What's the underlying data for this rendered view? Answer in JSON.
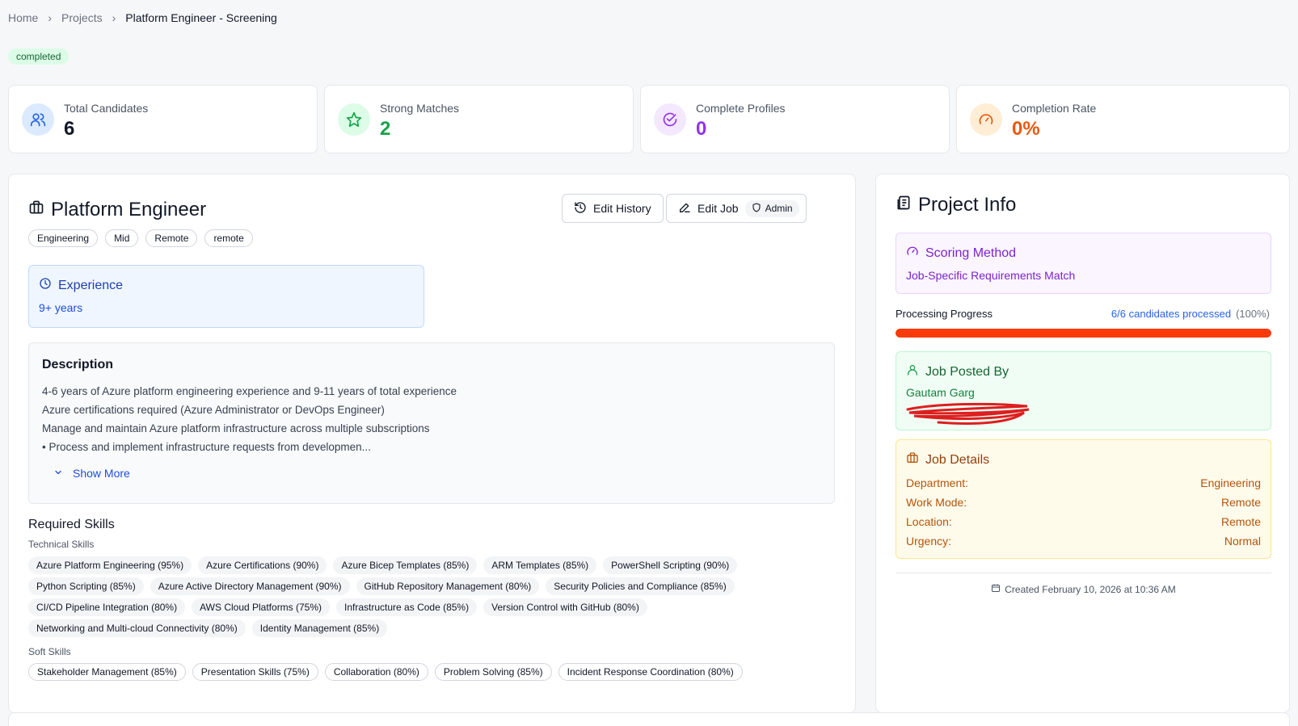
{
  "breadcrumb": {
    "home": "Home",
    "projects": "Projects",
    "current": "Platform Engineer - Screening"
  },
  "status": "completed",
  "stats": {
    "total": {
      "label": "Total Candidates",
      "value": "6",
      "color": "#111827",
      "icon": "users-icon"
    },
    "strong": {
      "label": "Strong Matches",
      "value": "2",
      "color": "#16a34a",
      "icon": "star-icon"
    },
    "complete": {
      "label": "Complete Profiles",
      "value": "0",
      "color": "#9333ea",
      "icon": "check-circle-icon"
    },
    "rate": {
      "label": "Completion Rate",
      "value": "0%",
      "color": "#ea580c",
      "icon": "gauge-icon"
    }
  },
  "job": {
    "title": "Platform Engineer",
    "tags": [
      "Engineering",
      "Mid",
      "Remote",
      "remote"
    ],
    "edit_history_label": "Edit History",
    "edit_job_label": "Edit Job",
    "admin_label": "Admin",
    "experience": {
      "title": "Experience",
      "value": "9+ years"
    },
    "description": {
      "title": "Description",
      "lines": [
        "4-6 years of Azure platform engineering experience and 9-11 years of total experience",
        "Azure certifications required (Azure Administrator or DevOps Engineer)",
        "Manage and maintain Azure platform infrastructure across multiple subscriptions",
        "• Process and implement infrastructure requests from developmen..."
      ],
      "show_more": "Show More"
    },
    "skills": {
      "title": "Required Skills",
      "technical_label": "Technical Skills",
      "technical": [
        "Azure Platform Engineering (95%)",
        "Azure Certifications (90%)",
        "Azure Bicep Templates (85%)",
        "ARM Templates (85%)",
        "PowerShell Scripting (90%)",
        "Python Scripting (85%)",
        "Azure Active Directory Management (90%)",
        "GitHub Repository Management (80%)",
        "Security Policies and Compliance (85%)",
        "CI/CD Pipeline Integration (80%)",
        "AWS Cloud Platforms (75%)",
        "Infrastructure as Code (85%)",
        "Version Control with GitHub (80%)",
        "Networking and Multi-cloud Connectivity (80%)",
        "Identity Management (85%)"
      ],
      "soft_label": "Soft Skills",
      "soft": [
        "Stakeholder Management (85%)",
        "Presentation Skills (75%)",
        "Collaboration (80%)",
        "Problem Solving (85%)",
        "Incident Response Coordination (80%)"
      ]
    }
  },
  "project_info": {
    "title": "Project Info",
    "scoring": {
      "title": "Scoring Method",
      "value": "Job-Specific Requirements Match"
    },
    "progress": {
      "label": "Processing Progress",
      "count_text": "6/6 candidates processed",
      "percent_text": "(100%)",
      "fraction": 1.0
    },
    "posted_by": {
      "title": "Job Posted By",
      "name": "Gautam Garg"
    },
    "details": {
      "title": "Job Details",
      "rows": [
        {
          "k": "Department:",
          "v": "Engineering"
        },
        {
          "k": "Work Mode:",
          "v": "Remote"
        },
        {
          "k": "Location:",
          "v": "Remote"
        },
        {
          "k": "Urgency:",
          "v": "Normal"
        }
      ]
    },
    "created": "Created February 10, 2026 at 10:36 AM"
  },
  "colors": {
    "accent_blue": "#2563eb",
    "progress": "#fb3a0c"
  }
}
